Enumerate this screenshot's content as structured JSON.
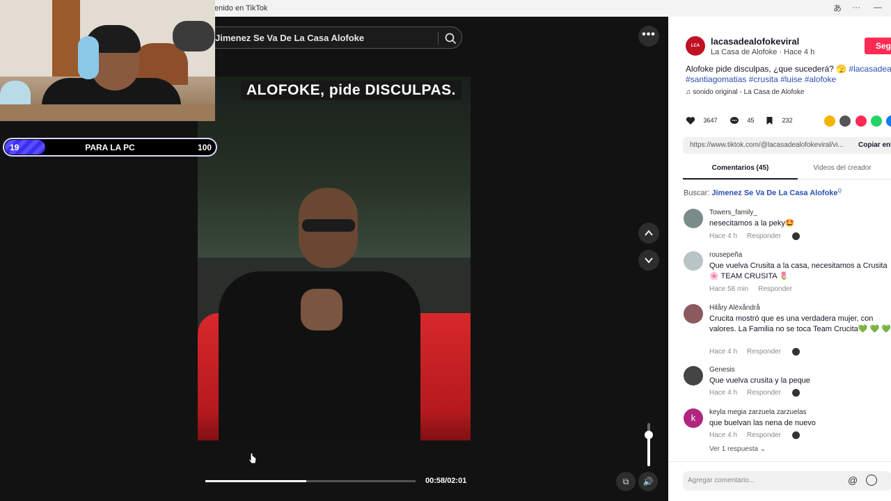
{
  "browser": {
    "tab_title": "enido en TikTok",
    "icons": [
      "translate-icon",
      "more-icon",
      "minimize-icon"
    ]
  },
  "video": {
    "search_query": "Jimenez Se Va De La Casa Alofoke",
    "caption": "ALOFOKE, pide DISCULPAS.",
    "current_time": "00:58",
    "duration": "02:01",
    "progress_fraction": 0.479,
    "time_text": "00:58/02:01",
    "volume_fraction": 0.72
  },
  "overlay": {
    "goal_current": "19",
    "goal_label": "PARA LA PC",
    "goal_max": "100",
    "goal_fraction": 0.19
  },
  "creator": {
    "handle": "lacasadealofokeviral",
    "name_time": "La Casa de Alofoke · Hace 4 h",
    "follow_label": "Seg",
    "description_text": "Alofoke pide disculpas, ¿que sucederá? 🫣 ",
    "description_tags_line1": "#lacasadealof",
    "description_tags_line2": "#santiagomatias #crusita #luise #alofoke",
    "sound": "♫  sonido original - La Casa de Alofoke"
  },
  "stats": {
    "likes": "3647",
    "comments": "45",
    "saves": "232"
  },
  "share": {
    "colors": [
      "#f4b400",
      "#555555",
      "#fe2c55",
      "#25d366",
      "#1877f2"
    ]
  },
  "link": {
    "url": "https://www.tiktok.com/@lacasadealofokeviral/vi...",
    "copy_label": "Copiar enl"
  },
  "tabs": {
    "comments": "Comentarios (45)",
    "creator_videos": "Videos del creador"
  },
  "search_line": {
    "label": "Buscar: ",
    "keyword": "Jimenez Se Va De La Casa Alofoke"
  },
  "comments": [
    {
      "user": "Towers_family_",
      "text": "nesecitamos a la peky🤩",
      "time": "Hace 4 h",
      "reply": "Responder",
      "avatar_color": "#7a8c8a"
    },
    {
      "user": "rousepeña",
      "text": "Que vuelva Crusita a la casa, necesitamos a Crusita 🌸 TEAM CRUSITA 🌷",
      "time": "Hace 58 min",
      "reply": "Responder",
      "avatar_color": "#b8c4c6"
    },
    {
      "user": "Hilåry Alëxåndrå",
      "text": "Crucita mostró que es una verdadera mujer, con valores. La Familia no se toca Team Crucita💚 💚 💚",
      "time": "Hace 4 h",
      "reply": "Responder",
      "avatar_color": "#8b5a5e"
    },
    {
      "user": "Genesis",
      "text": "Que vuelva crusita y la peque",
      "time": "Hace 4 h",
      "reply": "Responder",
      "avatar_color": "#444444"
    },
    {
      "user": "keyla megia zarzuela zarzuelas",
      "text": "que buelvan las nena de nuevo",
      "time": "Hace 4 h",
      "reply": "Responder",
      "avatar_color": "#b0267f",
      "avatar_letter": "k"
    }
  ],
  "more_replies": "Ver 1 respuesta ⌄",
  "add_comment": {
    "placeholder": "Agregar comentario..."
  }
}
